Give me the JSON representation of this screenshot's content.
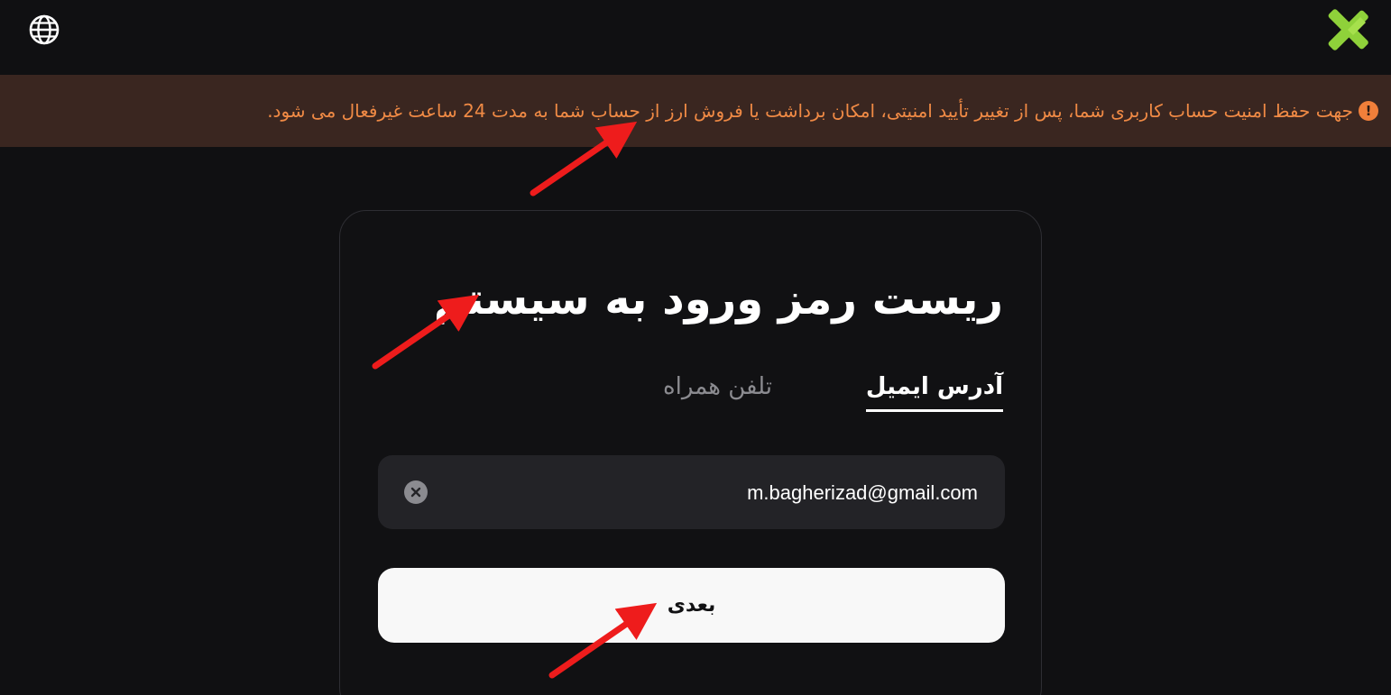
{
  "topbar": {
    "language_icon": "globe-icon",
    "logo_icon": "x-logo-icon",
    "logo_color": "#8fd13a"
  },
  "banner": {
    "icon": "warning-icon",
    "icon_glyph": "!",
    "text": "جهت حفظ امنیت حساب کاربری شما، پس از تغییر تأیید امنیتی، امکان برداشت یا فروش ارز از حساب شما به مدت 24 ساعت غیرفعال می شود.",
    "text_color": "#f08a45",
    "background": "#3a2620"
  },
  "form": {
    "title": "ریست رمز ورود به سیستم",
    "tabs": [
      {
        "label": "آدرس ایمیل",
        "active": true
      },
      {
        "label": "تلفن همراه",
        "active": false
      }
    ],
    "email_value": "m.bagherizad@gmail.com",
    "clear_icon": "clear-icon",
    "next_label": "بعدی"
  },
  "annotations": {
    "arrow_color": "#ee1c1c",
    "arrow_icon": "red-arrow-annotation"
  }
}
